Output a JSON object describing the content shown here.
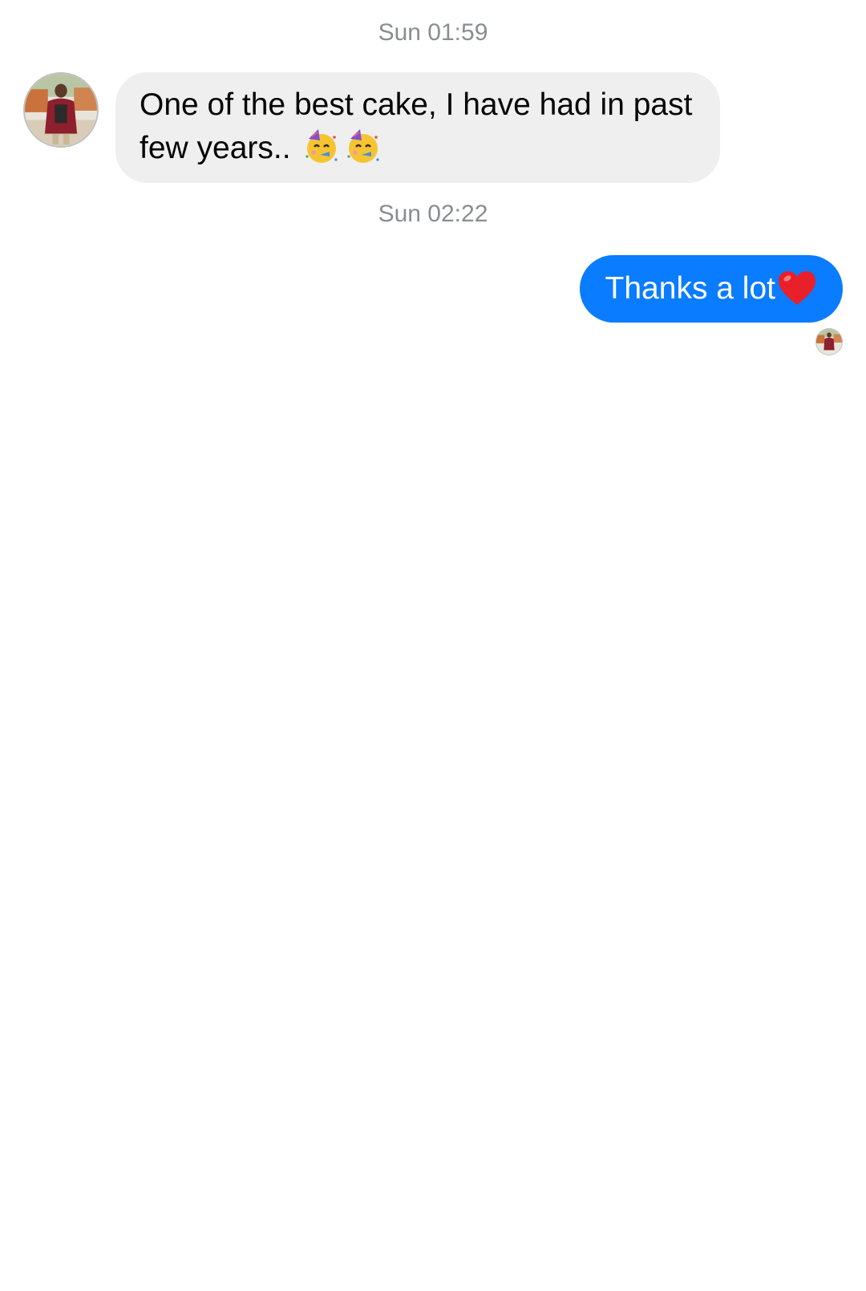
{
  "conversation": {
    "messages": [
      {
        "timestamp": "Sun 01:59",
        "direction": "incoming",
        "text": "One of the best cake, I have had in past few years..",
        "emojis": [
          "partying-face",
          "partying-face"
        ],
        "bubble_color": "#efefef"
      },
      {
        "timestamp": "Sun 02:22",
        "direction": "outgoing",
        "text": "Thanks a lot",
        "emojis": [
          "red-heart"
        ],
        "bubble_color": "#0a7cff"
      }
    ],
    "read_receipt": "contact-avatar"
  },
  "colors": {
    "outgoing_bubble": "#0a7cff",
    "incoming_bubble": "#efefef",
    "timestamp_text": "#8a8d91"
  }
}
